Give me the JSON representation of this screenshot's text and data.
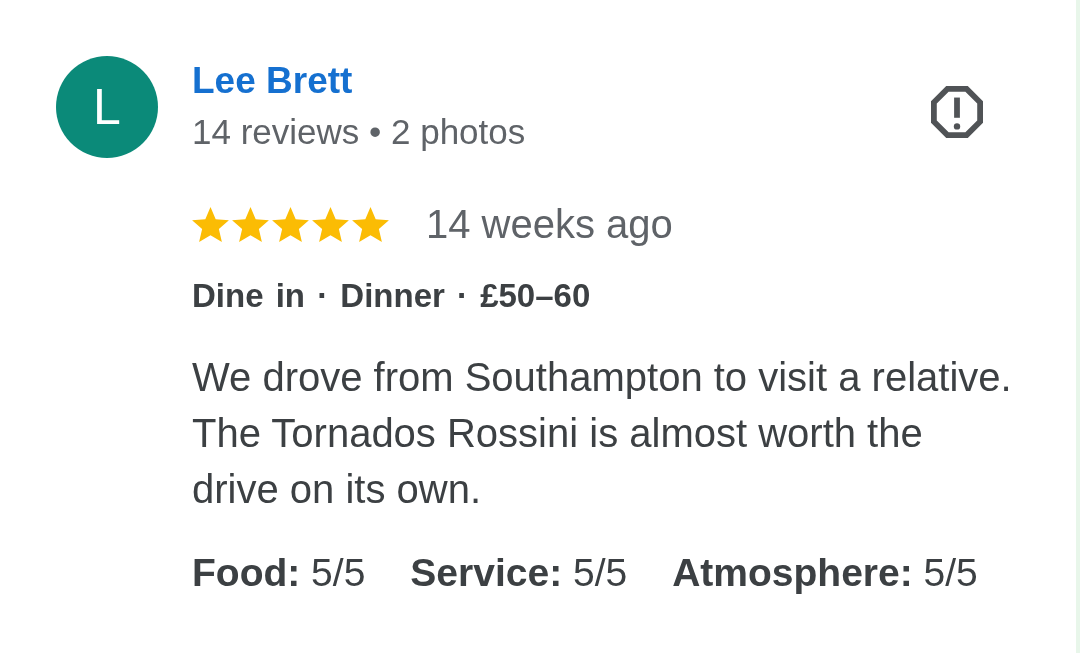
{
  "review": {
    "author": {
      "initial": "L",
      "name": "Lee Brett",
      "meta": "14 reviews • 2 photos"
    },
    "stars": 5,
    "time": "14 weeks ago",
    "details": "Dine in · Dinner · £50–60",
    "text": "We drove from Southampton to visit a relative. The Tornados Rossini is almost worth the drive on its own.",
    "ratings": [
      "**Food:** 5/5",
      "**Service:** 5/5",
      "**Atmosphere:** 5/5"
    ]
  }
}
